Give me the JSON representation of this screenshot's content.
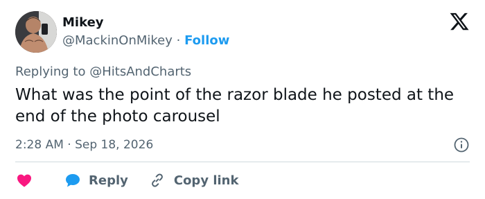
{
  "author": {
    "name": "Mikey",
    "handle": "@MackinOnMikey",
    "separator": "·",
    "follow_label": "Follow"
  },
  "replying": {
    "prefix": "Replying to",
    "target": "@HitsAndCharts"
  },
  "tweet": {
    "text": "What was the point of the razor blade he posted at the end of the photo carousel"
  },
  "meta": {
    "time": "2:28 AM",
    "separator": "·",
    "date": "Sep 18, 2026"
  },
  "actions": {
    "reply_label": "Reply",
    "copy_link_label": "Copy link"
  },
  "colors": {
    "accent": "#1d9bf0",
    "like": "#f91880",
    "text_primary": "#0f1419",
    "text_secondary": "#536471"
  },
  "icons": [
    "x-logo-icon",
    "info-icon",
    "heart-icon",
    "reply-bubble-icon",
    "link-icon"
  ]
}
